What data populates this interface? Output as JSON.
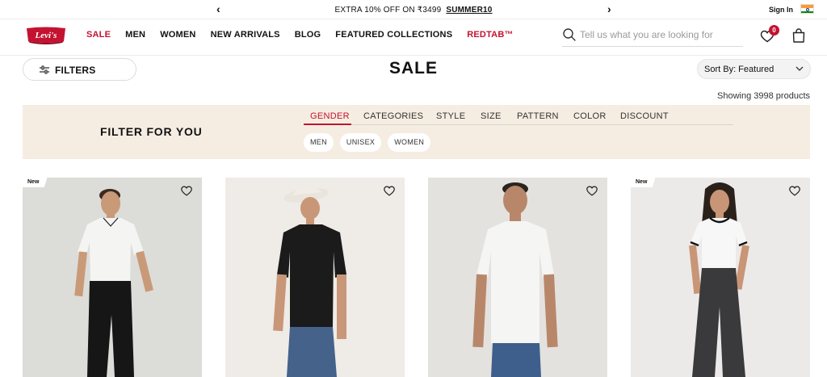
{
  "announcement": {
    "prev_icon": "chevron-left-icon",
    "text": "EXTRA 10% OFF ON ₹3499",
    "code": "SUMMER10",
    "next_icon": "chevron-right-icon",
    "sign_in": "Sign In",
    "flag_icon": "india-flag-icon"
  },
  "header": {
    "logo_text": "Levi's",
    "nav": [
      {
        "label": "SALE",
        "highlight": true
      },
      {
        "label": "MEN",
        "highlight": false
      },
      {
        "label": "WOMEN",
        "highlight": false
      },
      {
        "label": "NEW ARRIVALS",
        "highlight": false
      },
      {
        "label": "BLOG",
        "highlight": false
      },
      {
        "label": "FEATURED COLLECTIONS",
        "highlight": false
      },
      {
        "label": "REDTAB™",
        "highlight": true
      }
    ],
    "search_placeholder": "Tell us what you are looking for",
    "wishlist_count": "0",
    "icons": {
      "search": "search-icon",
      "wishlist": "heart-icon",
      "cart": "shopping-bag-icon"
    }
  },
  "toolbar": {
    "filters_label": "FILTERS",
    "filters_icon": "sliders-icon",
    "page_title": "SALE",
    "sort_label": "Sort By: Featured",
    "sort_icon": "chevron-down-icon",
    "showing": "Showing 3998 products"
  },
  "filter_for_you": {
    "title": "FILTER FOR YOU",
    "tabs": [
      "GENDER",
      "CATEGORIES",
      "STYLE",
      "SIZE",
      "PATTERN",
      "COLOR",
      "DISCOUNT"
    ],
    "active_tab": "GENDER",
    "chips": [
      "MEN",
      "UNISEX",
      "WOMEN"
    ]
  },
  "products": [
    {
      "tag": "New",
      "description": "man in white polo t-shirt and black jeans",
      "wishlist_icon": "heart-icon"
    },
    {
      "tag": "",
      "description": "man in cap with black t-shirt and blue jeans",
      "wishlist_icon": "heart-icon"
    },
    {
      "tag": "",
      "description": "man in white crew neck t-shirt and blue jeans",
      "wishlist_icon": "heart-icon"
    },
    {
      "tag": "New",
      "description": "woman in white ringer tee and black wide-leg jeans",
      "wishlist_icon": "heart-icon"
    }
  ],
  "colors": {
    "brand_red": "#c41230",
    "filter_band": "#f5ede2",
    "text": "#111111"
  }
}
